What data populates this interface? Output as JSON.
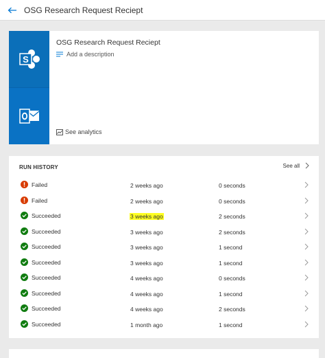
{
  "header": {
    "title": "OSG Research Request Reciept"
  },
  "flow": {
    "name": "OSG Research Request Reciept",
    "add_description": "Add a description",
    "see_analytics": "See analytics",
    "connectors": [
      "sharepoint-icon",
      "outlook-icon"
    ]
  },
  "run_history": {
    "title": "RUN HISTORY",
    "see_all": "See all",
    "runs": [
      {
        "status": "Failed",
        "when": "2 weeks ago",
        "duration": "0 seconds"
      },
      {
        "status": "Failed",
        "when": "2 weeks ago",
        "duration": "0 seconds"
      },
      {
        "status": "Succeeded",
        "when": "3 weeks ago",
        "duration": "2 seconds"
      },
      {
        "status": "Succeeded",
        "when": "3 weeks ago",
        "duration": "2 seconds"
      },
      {
        "status": "Succeeded",
        "when": "3 weeks ago",
        "duration": "1 second"
      },
      {
        "status": "Succeeded",
        "when": "3 weeks ago",
        "duration": "1 second"
      },
      {
        "status": "Succeeded",
        "when": "4 weeks ago",
        "duration": "0 seconds"
      },
      {
        "status": "Succeeded",
        "when": "4 weeks ago",
        "duration": "1 second"
      },
      {
        "status": "Succeeded",
        "when": "4 weeks ago",
        "duration": "2 seconds"
      },
      {
        "status": "Succeeded",
        "when": "1 month ago",
        "duration": "1 second"
      }
    ]
  },
  "colors": {
    "accent": "#0078d4",
    "sharepoint": "#0b6fb9",
    "outlook": "#0a72c4",
    "failed": "#d83b01",
    "succeeded": "#107c10",
    "highlight": "#ffff22"
  }
}
